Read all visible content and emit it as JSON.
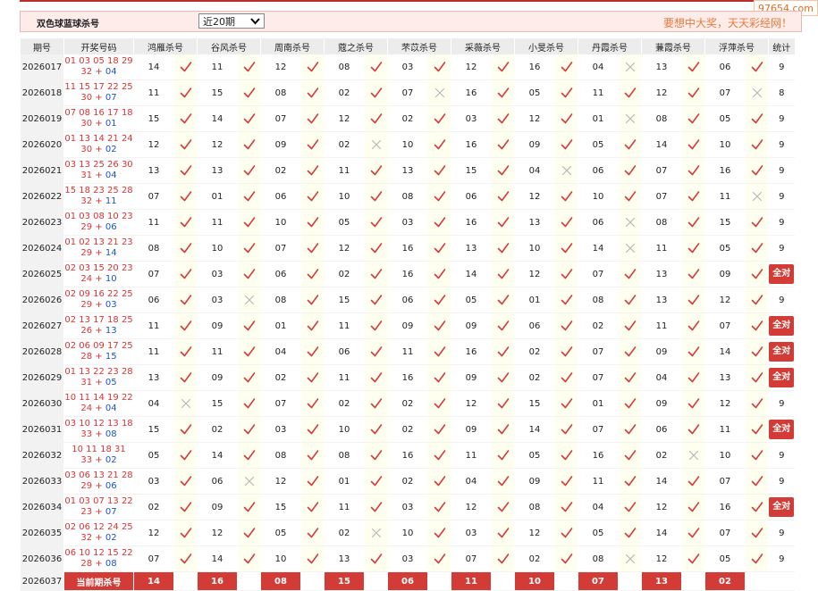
{
  "header": {
    "title": "双色球蓝球杀号",
    "select_value": "近20期",
    "slogan": "要想中大奖，天天彩经网！"
  },
  "watermark": "97654.com",
  "columns": {
    "period": "期号",
    "draw": "开奖号码",
    "experts": [
      "鸿雁杀号",
      "谷风杀号",
      "周南杀号",
      "蔻之杀号",
      "芣苡杀号",
      "采薇杀号",
      "小旻杀号",
      "丹霞杀号",
      "蒹霞杀号",
      "浮萍杀号"
    ],
    "stat": "统计"
  },
  "rows": [
    {
      "period": "2026017",
      "red1": "01 03 05 18 29",
      "red2": "32",
      "blue": "04",
      "kills": [
        "14",
        "11",
        "12",
        "08",
        "03",
        "12",
        "16",
        "04",
        "13",
        "06"
      ],
      "hits": [
        1,
        1,
        1,
        1,
        1,
        1,
        1,
        0,
        1,
        1
      ],
      "stat": "9"
    },
    {
      "period": "2026018",
      "red1": "11 15 17 22 25",
      "red2": "30",
      "blue": "07",
      "kills": [
        "11",
        "15",
        "08",
        "02",
        "07",
        "16",
        "05",
        "11",
        "12",
        "07"
      ],
      "hits": [
        1,
        1,
        1,
        1,
        0,
        1,
        1,
        1,
        1,
        0
      ],
      "stat": "8"
    },
    {
      "period": "2026019",
      "red1": "07 08 16 17 18",
      "red2": "30",
      "blue": "01",
      "kills": [
        "15",
        "14",
        "07",
        "12",
        "02",
        "03",
        "12",
        "01",
        "08",
        "05"
      ],
      "hits": [
        1,
        1,
        1,
        1,
        1,
        1,
        1,
        0,
        1,
        1
      ],
      "stat": "9"
    },
    {
      "period": "2026020",
      "red1": "01 13 14 21 24",
      "red2": "30",
      "blue": "02",
      "kills": [
        "12",
        "12",
        "09",
        "02",
        "10",
        "16",
        "09",
        "05",
        "14",
        "10"
      ],
      "hits": [
        1,
        1,
        1,
        0,
        1,
        1,
        1,
        1,
        1,
        1
      ],
      "stat": "9"
    },
    {
      "period": "2026021",
      "red1": "03 13 25 26 30",
      "red2": "31",
      "blue": "04",
      "kills": [
        "13",
        "13",
        "02",
        "11",
        "13",
        "15",
        "04",
        "06",
        "07",
        "16"
      ],
      "hits": [
        1,
        1,
        1,
        1,
        1,
        1,
        0,
        1,
        1,
        1
      ],
      "stat": "9"
    },
    {
      "period": "2026022",
      "red1": "15 18 23 25 28",
      "red2": "32",
      "blue": "11",
      "kills": [
        "07",
        "01",
        "06",
        "10",
        "08",
        "06",
        "12",
        "10",
        "07",
        "11"
      ],
      "hits": [
        1,
        1,
        1,
        1,
        1,
        1,
        1,
        1,
        1,
        0
      ],
      "stat": "9"
    },
    {
      "period": "2026023",
      "red1": "01 03 08 10 23",
      "red2": "29",
      "blue": "06",
      "kills": [
        "11",
        "11",
        "10",
        "05",
        "03",
        "16",
        "13",
        "06",
        "08",
        "15"
      ],
      "hits": [
        1,
        1,
        1,
        1,
        1,
        1,
        1,
        0,
        1,
        1
      ],
      "stat": "9"
    },
    {
      "period": "2026024",
      "red1": "01 02 13 21 23",
      "red2": "29",
      "blue": "14",
      "kills": [
        "08",
        "10",
        "07",
        "12",
        "16",
        "13",
        "10",
        "14",
        "11",
        "05"
      ],
      "hits": [
        1,
        1,
        1,
        1,
        1,
        1,
        1,
        0,
        1,
        1
      ],
      "stat": "9"
    },
    {
      "period": "2026025",
      "red1": "02 03 15 20 23",
      "red2": "24",
      "blue": "10",
      "kills": [
        "07",
        "03",
        "06",
        "02",
        "16",
        "14",
        "12",
        "07",
        "13",
        "09"
      ],
      "hits": [
        1,
        1,
        1,
        1,
        1,
        1,
        1,
        1,
        1,
        1
      ],
      "stat": "全对"
    },
    {
      "period": "2026026",
      "red1": "02 09 16 22 25",
      "red2": "29",
      "blue": "03",
      "kills": [
        "06",
        "03",
        "08",
        "15",
        "06",
        "05",
        "01",
        "08",
        "13",
        "12"
      ],
      "hits": [
        1,
        0,
        1,
        1,
        1,
        1,
        1,
        1,
        1,
        1
      ],
      "stat": "9"
    },
    {
      "period": "2026027",
      "red1": "02 13 17 18 25",
      "red2": "26",
      "blue": "13",
      "kills": [
        "11",
        "09",
        "01",
        "11",
        "09",
        "09",
        "06",
        "02",
        "11",
        "07"
      ],
      "hits": [
        1,
        1,
        1,
        1,
        1,
        1,
        1,
        1,
        1,
        1
      ],
      "stat": "全对"
    },
    {
      "period": "2026028",
      "red1": "02 06 09 17 25",
      "red2": "28",
      "blue": "15",
      "kills": [
        "11",
        "11",
        "04",
        "06",
        "11",
        "16",
        "02",
        "07",
        "09",
        "14"
      ],
      "hits": [
        1,
        1,
        1,
        1,
        1,
        1,
        1,
        1,
        1,
        1
      ],
      "stat": "全对"
    },
    {
      "period": "2026029",
      "red1": "01 13 22 23 28",
      "red2": "31",
      "blue": "05",
      "kills": [
        "13",
        "09",
        "02",
        "11",
        "16",
        "09",
        "02",
        "07",
        "04",
        "13"
      ],
      "hits": [
        1,
        1,
        1,
        1,
        1,
        1,
        1,
        1,
        1,
        1
      ],
      "stat": "全对"
    },
    {
      "period": "2026030",
      "red1": "10 11 14 19 22",
      "red2": "24",
      "blue": "04",
      "kills": [
        "04",
        "15",
        "07",
        "02",
        "02",
        "12",
        "15",
        "01",
        "09",
        "12"
      ],
      "hits": [
        0,
        1,
        1,
        1,
        1,
        1,
        1,
        1,
        1,
        1
      ],
      "stat": "9"
    },
    {
      "period": "2026031",
      "red1": "03 10 12 13 18",
      "red2": "33",
      "blue": "08",
      "kills": [
        "15",
        "02",
        "03",
        "10",
        "02",
        "09",
        "14",
        "07",
        "06",
        "11"
      ],
      "hits": [
        1,
        1,
        1,
        1,
        1,
        1,
        1,
        1,
        1,
        1
      ],
      "stat": "全对"
    },
    {
      "period": "2026032",
      "red1": "10 11 18 31",
      "red2": "33",
      "blue": "02",
      "kills": [
        "05",
        "14",
        "08",
        "08",
        "16",
        "11",
        "05",
        "16",
        "02",
        "10"
      ],
      "hits": [
        1,
        1,
        1,
        1,
        1,
        1,
        1,
        1,
        0,
        1
      ],
      "stat": "9"
    },
    {
      "period": "2026033",
      "red1": "03 06 13 21 28",
      "red2": "29",
      "blue": "06",
      "kills": [
        "03",
        "06",
        "12",
        "01",
        "02",
        "04",
        "09",
        "11",
        "14",
        "07"
      ],
      "hits": [
        1,
        0,
        1,
        1,
        1,
        1,
        1,
        1,
        1,
        1
      ],
      "stat": "9"
    },
    {
      "period": "2026034",
      "red1": "01 03 07 13 22",
      "red2": "23",
      "blue": "07",
      "kills": [
        "02",
        "09",
        "15",
        "11",
        "03",
        "12",
        "08",
        "04",
        "12",
        "16"
      ],
      "hits": [
        1,
        1,
        1,
        1,
        1,
        1,
        1,
        1,
        1,
        1
      ],
      "stat": "全对"
    },
    {
      "period": "2026035",
      "red1": "02 06 12 24 25",
      "red2": "32",
      "blue": "02",
      "kills": [
        "12",
        "12",
        "05",
        "02",
        "10",
        "03",
        "12",
        "05",
        "14",
        "07"
      ],
      "hits": [
        1,
        1,
        1,
        0,
        1,
        1,
        1,
        1,
        1,
        1
      ],
      "stat": "9"
    },
    {
      "period": "2026036",
      "red1": "06 10 12 15 22",
      "red2": "28",
      "blue": "08",
      "kills": [
        "07",
        "14",
        "10",
        "13",
        "03",
        "07",
        "02",
        "08",
        "12",
        "05"
      ],
      "hits": [
        1,
        1,
        1,
        1,
        1,
        1,
        1,
        0,
        1,
        1
      ],
      "stat": "9"
    }
  ],
  "current": {
    "period": "2026037",
    "label": "当前期杀号",
    "kills": [
      "14",
      "16",
      "08",
      "15",
      "06",
      "11",
      "10",
      "07",
      "13",
      "02"
    ]
  },
  "colors": {
    "accent": "#d33b36",
    "red_number": "#dd3333",
    "blue_number": "#1a55c9",
    "check": "#d63b3b",
    "cross": "#b8b8b8"
  }
}
